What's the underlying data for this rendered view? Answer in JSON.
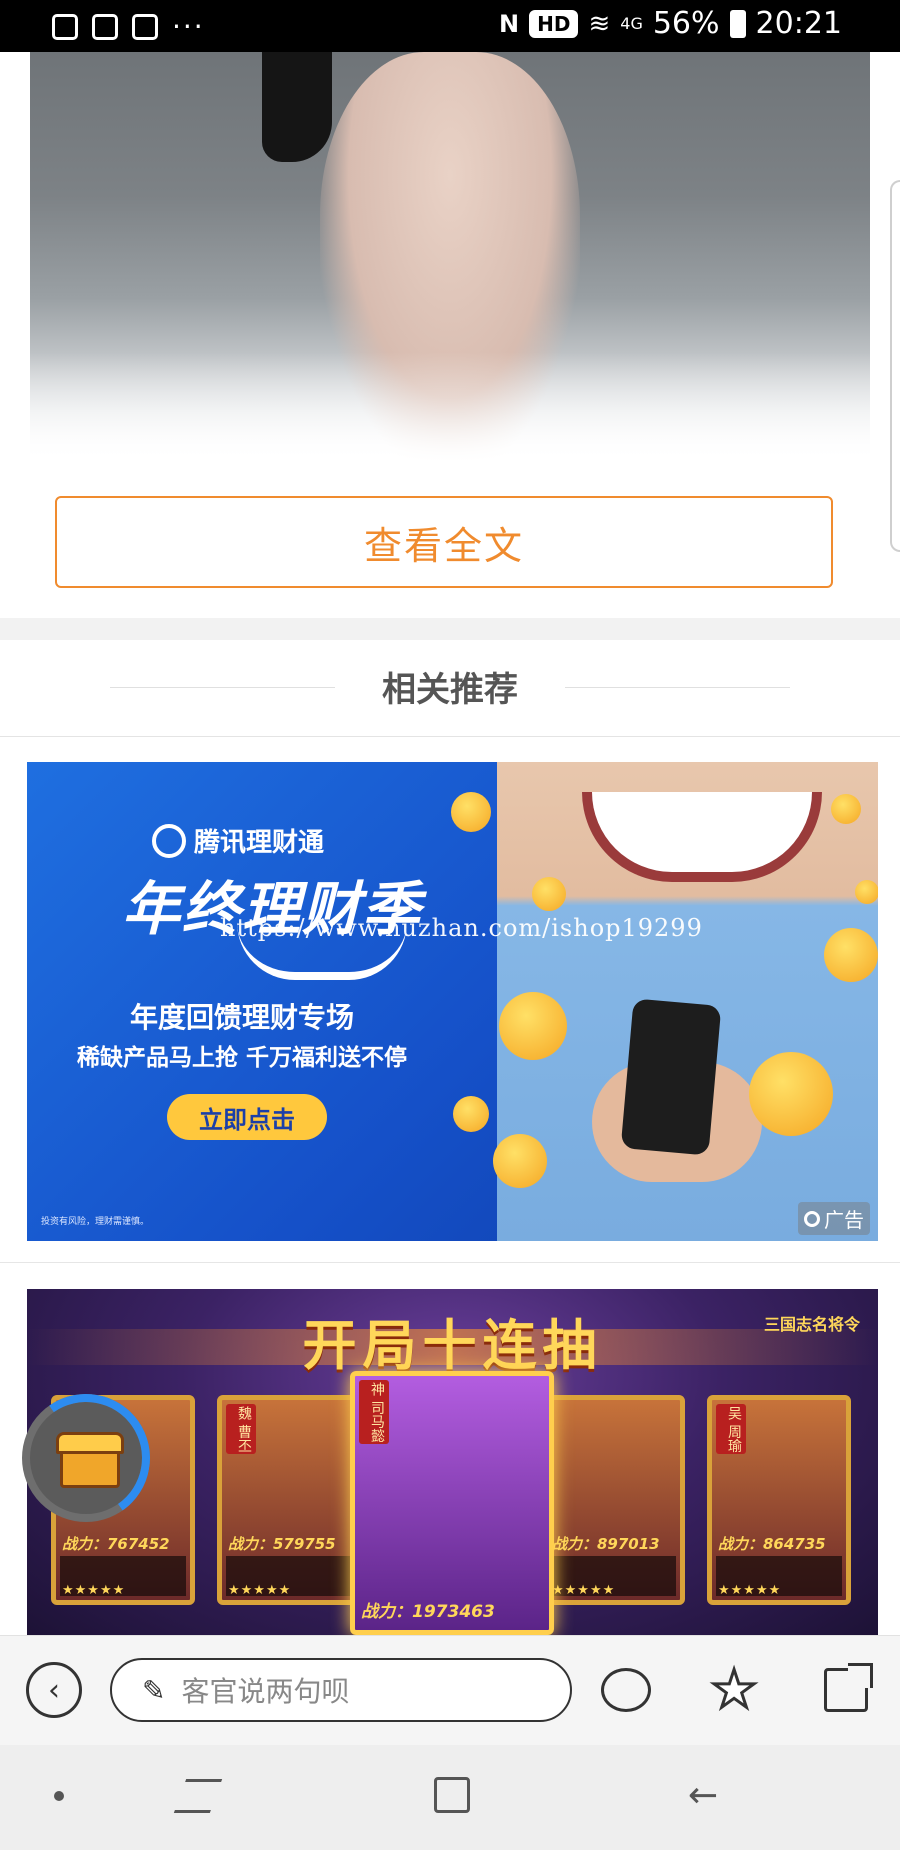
{
  "status_bar": {
    "time": "20:21",
    "battery": "56%",
    "network": "4G",
    "hd": "HD",
    "more": "···"
  },
  "article": {
    "view_full_label": "查看全文"
  },
  "related": {
    "title": "相关推荐"
  },
  "ad1": {
    "brand": "腾讯理财通",
    "headline": "年终理财季",
    "line1": "年度回馈理财专场",
    "line2": "稀缺产品马上抢 千万福利送不停",
    "cta": "立即点击",
    "disclaimer": "投资有风险，理财需谨慎。",
    "tag": "广告",
    "watermark": "https://www.huzhan.com/ishop19299"
  },
  "ad2": {
    "title": "开局十连抽",
    "logo": "三国志名将令",
    "cards": [
      {
        "name": "",
        "power": "战力：767452",
        "stars": "★★★★★"
      },
      {
        "name": "魏 曹丕",
        "power": "战力：579755",
        "stars": "★★★★★"
      },
      {
        "name": "神 司马懿",
        "power": "战力：1973463",
        "stars": "★★★★★"
      },
      {
        "name": "",
        "power": "战力：897013",
        "stars": "★★★★★"
      },
      {
        "name": "吴 周瑜",
        "power": "战力：864735",
        "stars": "★★★★★"
      }
    ]
  },
  "bottom_bar": {
    "back_icon": "back-circle-icon",
    "comment_placeholder": "客官说两句呗",
    "comment_icon": "comment-bubble-icon",
    "favorite_icon": "star-icon",
    "share_icon": "share-icon"
  },
  "colors": {
    "accent": "#f08b2e",
    "ad_blue": "#1f6fe0",
    "progress_blue": "#2d8cf0"
  }
}
